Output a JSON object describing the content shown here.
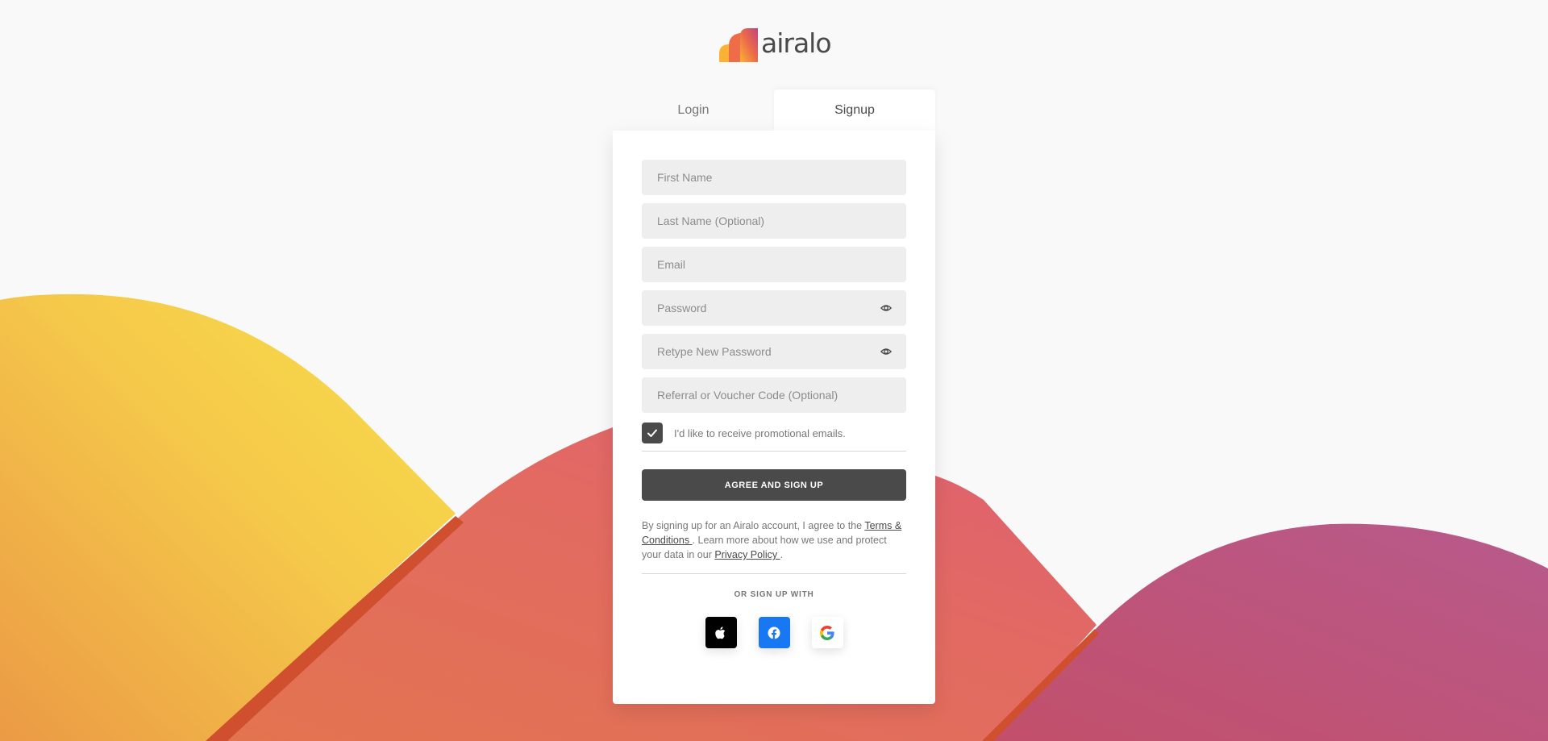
{
  "brand": {
    "name": "airalo",
    "colors": {
      "accent_dark": "#4a4a4a",
      "yellow": "#f7dc4a",
      "orange": "#e8784e",
      "coral": "#e0636e",
      "magenta": "#c05880",
      "facebook_blue": "#1877f2"
    }
  },
  "tabs": {
    "login_label": "Login",
    "signup_label": "Signup",
    "active": "Signup"
  },
  "form": {
    "first_name_placeholder": "First Name",
    "last_name_placeholder": "Last Name (Optional)",
    "email_placeholder": "Email",
    "password_placeholder": "Password",
    "retype_password_placeholder": "Retype New Password",
    "referral_placeholder": "Referral or Voucher Code (Optional)",
    "promo_checkbox_label": "I'd like to receive promotional emails.",
    "promo_checked": true,
    "submit_label": "AGREE AND SIGN UP"
  },
  "legal": {
    "prefix": "By signing up for an Airalo account, I agree to the ",
    "terms_link": "Terms & Conditions ",
    "middle": ". Learn more about how we use and protect your data in our ",
    "privacy_link": "Privacy Policy ",
    "suffix": "."
  },
  "social": {
    "heading": "OR SIGN UP WITH",
    "providers": [
      {
        "name": "Apple",
        "icon": "apple-icon"
      },
      {
        "name": "Facebook",
        "icon": "facebook-icon"
      },
      {
        "name": "Google",
        "icon": "google-icon"
      }
    ]
  }
}
